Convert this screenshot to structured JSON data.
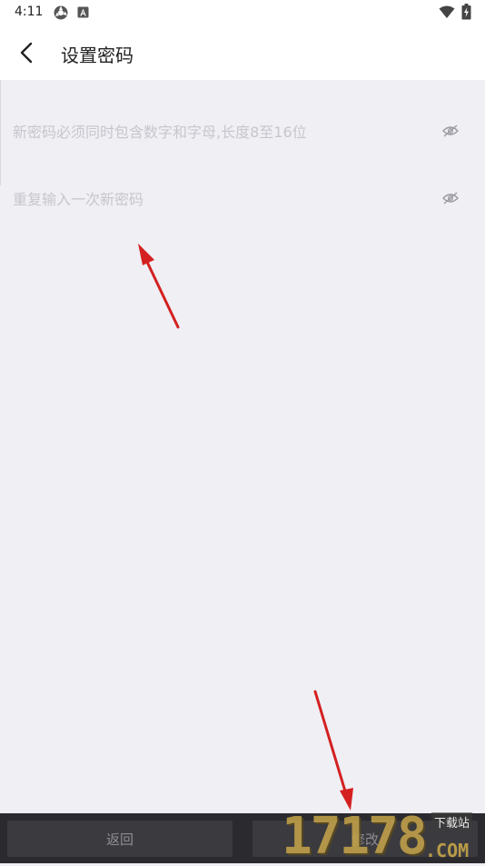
{
  "status_bar": {
    "time": "4:11"
  },
  "header": {
    "title": "设置密码"
  },
  "form": {
    "new_password_placeholder": "新密码必须同时包含数字和字母,长度8至16位",
    "confirm_password_placeholder": "重复输入一次新密码"
  },
  "footer": {
    "back_label": "返回",
    "submit_label": "修改"
  },
  "watermark": {
    "number": "17178",
    "label": "下载站",
    "domain": ".COM"
  },
  "colors": {
    "background": "#efeff4",
    "annotation_arrow": "#d42020",
    "bottom_bar": "#2b2b2f"
  }
}
